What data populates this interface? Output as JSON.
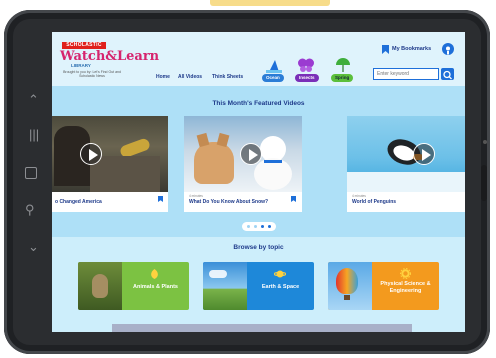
{
  "header": {
    "brand_tag": "SCHOLASTIC",
    "brand_name": "Watch&Learn",
    "brand_sub": "LIBRARY",
    "brand_tagline": "Brought to you by: Let's Find Out and Scholastic News",
    "nav": [
      "Home",
      "All Videos",
      "Think Sheets"
    ],
    "chips": [
      "Ocean",
      "Insects",
      "Spring"
    ],
    "bookmarks_label": "My Bookmarks",
    "search_placeholder": "Enter keyword"
  },
  "featured": {
    "title": "This Month's Featured Videos",
    "cards": [
      {
        "title": "o Changed America",
        "meta": ""
      },
      {
        "title": "What Do You Know About Snow?",
        "meta": "4 minutes"
      },
      {
        "title": "World of Penguins",
        "meta": "4 minutes"
      }
    ]
  },
  "browse": {
    "title": "Browse by topic",
    "topics": [
      {
        "label": "Animals & Plants",
        "color": "#7cc242"
      },
      {
        "label": "Earth & Space",
        "color": "#1e88d9"
      },
      {
        "label": "Physical Science & Engineering",
        "color": "#f39a1e"
      }
    ]
  },
  "colors": {
    "accent": "#1e6fd9",
    "navy": "#1e3a8a",
    "background": "#aee0f7"
  }
}
